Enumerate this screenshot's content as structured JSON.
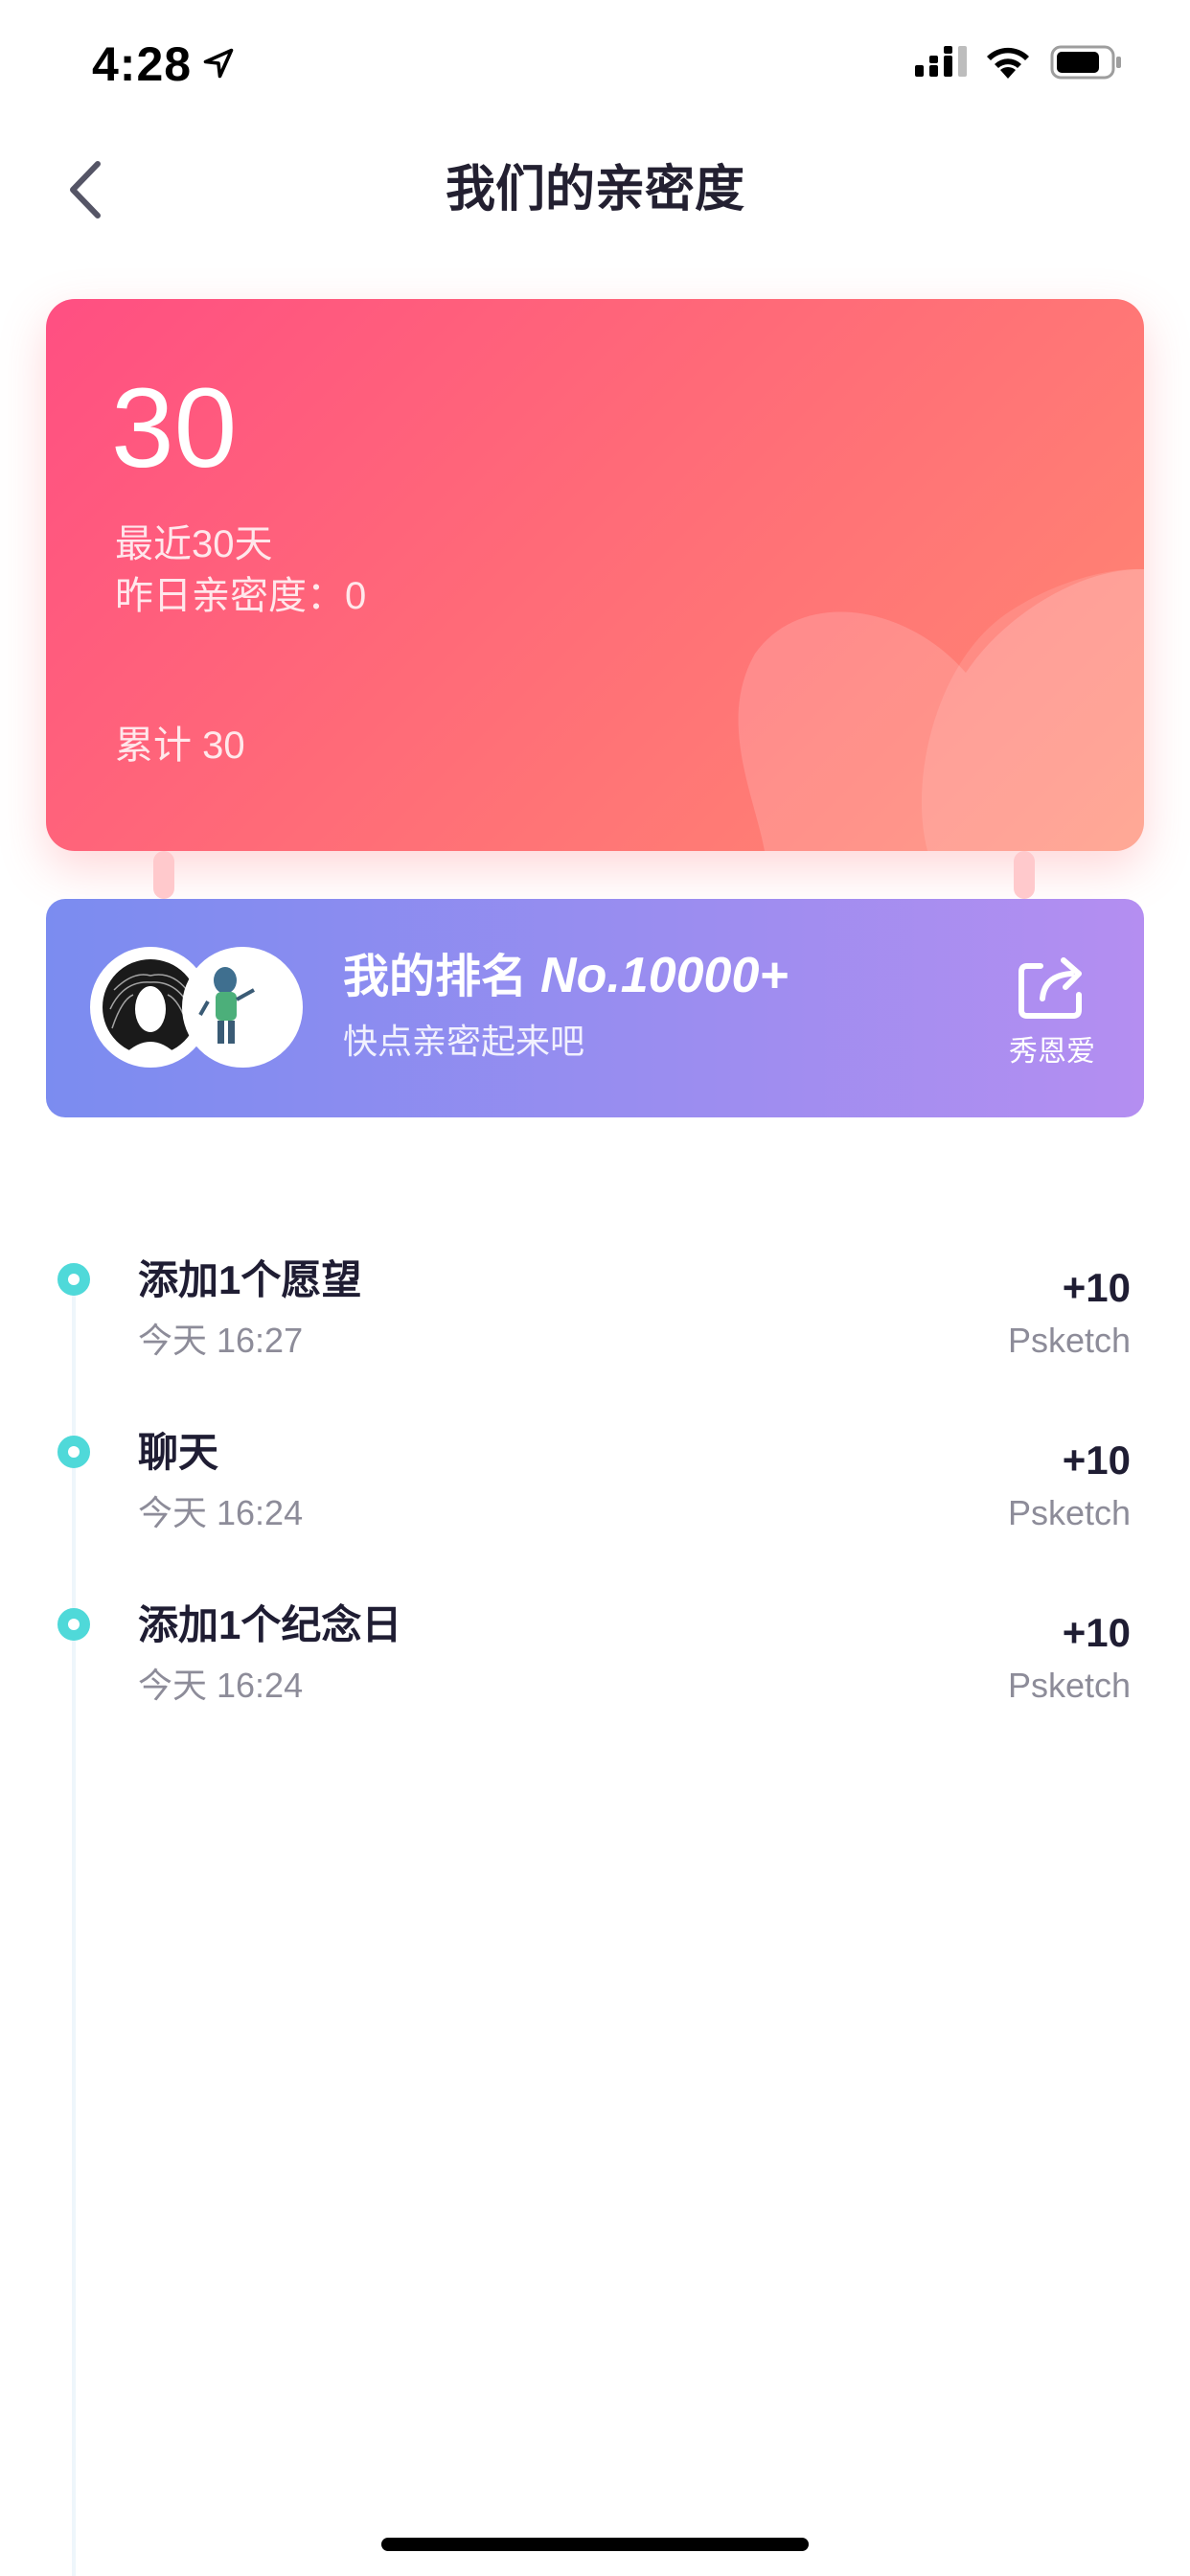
{
  "status_bar": {
    "time": "4:28"
  },
  "nav": {
    "title": "我们的亲密度"
  },
  "score_card": {
    "score": "30",
    "period": "最近30天",
    "yesterday": "昨日亲密度：0",
    "total": "累计 30"
  },
  "ranking": {
    "title": "我的排名",
    "rank": "No.10000+",
    "subtitle": "快点亲密起来吧",
    "share_label": "秀恩爱"
  },
  "timeline": [
    {
      "title": "添加1个愿望",
      "time": "今天 16:27",
      "points": "+10",
      "user": "Psketch"
    },
    {
      "title": "聊天",
      "time": "今天 16:24",
      "points": "+10",
      "user": "Psketch"
    },
    {
      "title": "添加1个纪念日",
      "time": "今天 16:24",
      "points": "+10",
      "user": "Psketch"
    }
  ],
  "colors": {
    "card_gradient_start": "#ff4f82",
    "card_gradient_end": "#ff8a72",
    "banner_gradient_start": "#7b8cf0",
    "banner_gradient_end": "#b48ef1",
    "timeline_dot": "#4fd9d9"
  }
}
